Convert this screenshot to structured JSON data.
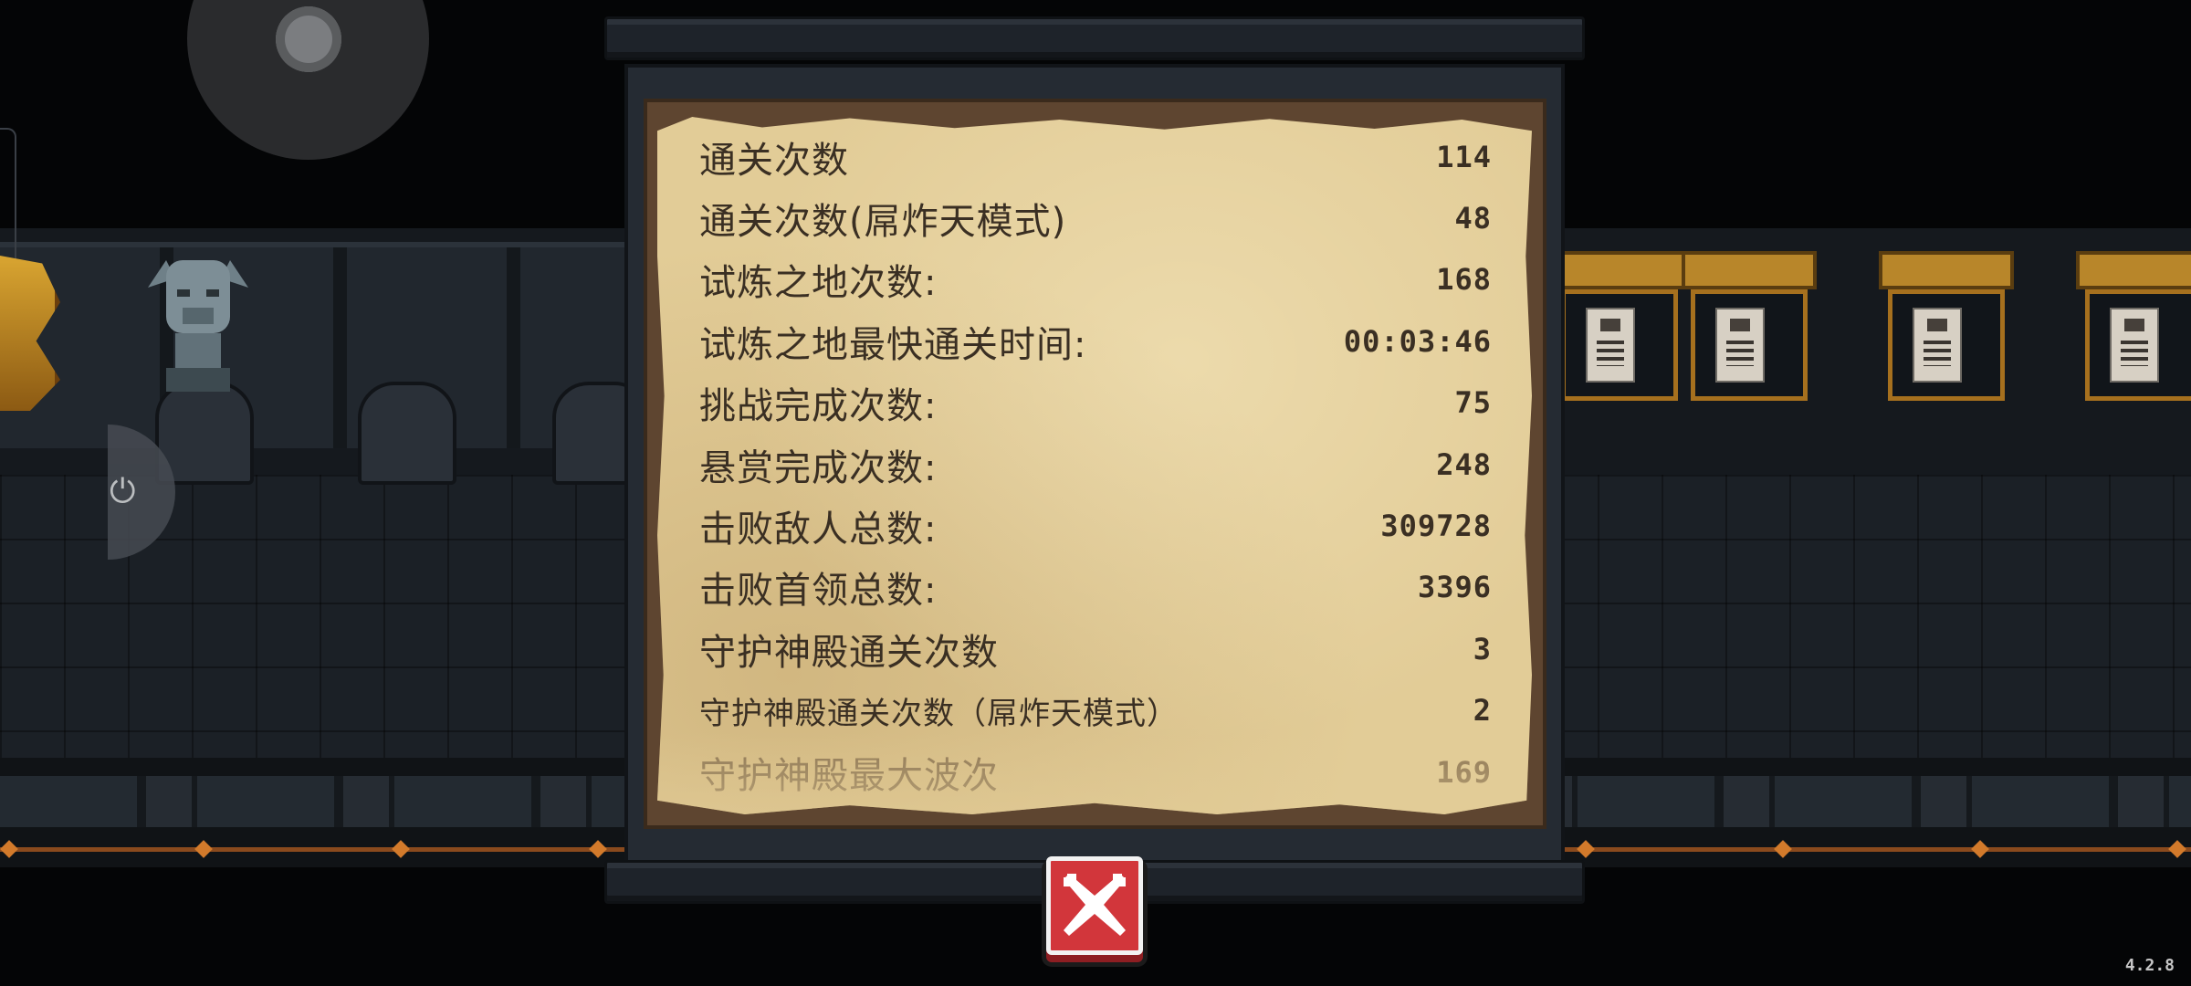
{
  "panel": {
    "stats": [
      {
        "label": "通关次数",
        "value": "114"
      },
      {
        "label": "通关次数(屌炸天模式)",
        "value": "48"
      },
      {
        "label": "试炼之地次数:",
        "value": "168"
      },
      {
        "label": "试炼之地最快通关时间:",
        "value": "00:03:46"
      },
      {
        "label": "挑战完成次数:",
        "value": "75"
      },
      {
        "label": "悬赏完成次数:",
        "value": "248"
      },
      {
        "label": "击败敌人总数:",
        "value": "309728"
      },
      {
        "label": "击败首领总数:",
        "value": "3396"
      },
      {
        "label": "守护神殿通关次数",
        "value": "3"
      },
      {
        "label": "守护神殿通关次数（屌炸天模式）",
        "value": "2"
      },
      {
        "label": "守护神殿最大波次",
        "value": "169"
      }
    ]
  },
  "close_button": {
    "icon": "close-icon",
    "color": "#d2363b"
  },
  "version": "4.2.8",
  "colors": {
    "parchment": "#e2cc97",
    "text": "#3a2f23",
    "frame": "#252b33"
  }
}
